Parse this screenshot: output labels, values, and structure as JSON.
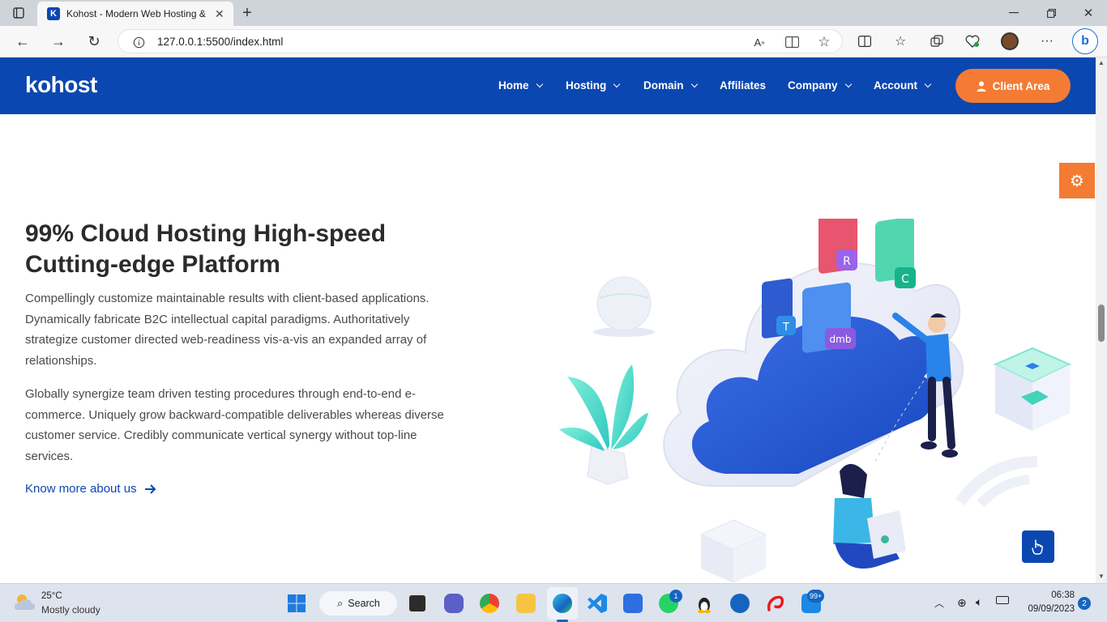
{
  "browser": {
    "tab_title": "Kohost - Modern Web Hosting &",
    "url": "127.0.0.1:5500/index.html"
  },
  "site": {
    "logo": "kohost",
    "nav": [
      {
        "label": "Home",
        "dropdown": true
      },
      {
        "label": "Hosting",
        "dropdown": true
      },
      {
        "label": "Domain",
        "dropdown": true
      },
      {
        "label": "Affiliates",
        "dropdown": false
      },
      {
        "label": "Company",
        "dropdown": true
      },
      {
        "label": "Account",
        "dropdown": true
      }
    ],
    "cta": "Client Area",
    "brand_color": "#0b47b0",
    "accent_color": "#f47b34"
  },
  "hero": {
    "title_line1": "99% Cloud Hosting High-speed",
    "title_line2": "Cutting-edge Platform",
    "para1": "Compellingly customize maintainable results with client-based applications. Dynamically fabricate B2C intellectual capital paradigms. Authoritatively strategize customer directed web-readiness vis-a-vis an expanded array of relationships.",
    "para2": "Globally synergize team driven testing procedures through end-to-end e-commerce. Uniquely grow backward-compatible deliverables whereas diverse customer service. Credibly communicate vertical synergy without top-line services.",
    "link": "Know more about us"
  },
  "illustration": {
    "card_letters": [
      "R",
      "C",
      "T",
      "dmb"
    ]
  },
  "taskbar": {
    "weather_temp": "25°C",
    "weather_desc": "Mostly cloudy",
    "search_label": "Search",
    "whatsapp_badge": "1",
    "store_badge": "99+",
    "time": "06:38",
    "date": "09/09/2023",
    "notif_count": "2"
  }
}
